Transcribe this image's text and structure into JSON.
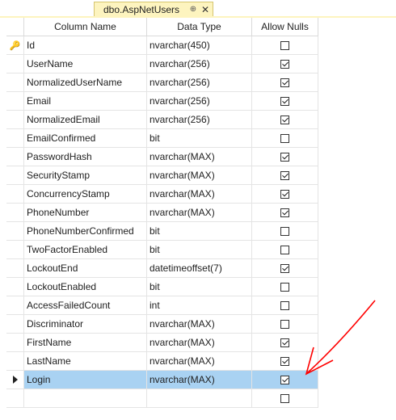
{
  "tab": {
    "title": "dbo.AspNetUsers",
    "pin": "⊕",
    "close": "✕"
  },
  "columns": {
    "name": "Column Name",
    "type": "Data Type",
    "nulls": "Allow Nulls"
  },
  "rows": [
    {
      "name": "Id",
      "type": "nvarchar(450)",
      "nulls": false,
      "key": true
    },
    {
      "name": "UserName",
      "type": "nvarchar(256)",
      "nulls": true
    },
    {
      "name": "NormalizedUserName",
      "type": "nvarchar(256)",
      "nulls": true
    },
    {
      "name": "Email",
      "type": "nvarchar(256)",
      "nulls": true
    },
    {
      "name": "NormalizedEmail",
      "type": "nvarchar(256)",
      "nulls": true
    },
    {
      "name": "EmailConfirmed",
      "type": "bit",
      "nulls": false
    },
    {
      "name": "PasswordHash",
      "type": "nvarchar(MAX)",
      "nulls": true
    },
    {
      "name": "SecurityStamp",
      "type": "nvarchar(MAX)",
      "nulls": true
    },
    {
      "name": "ConcurrencyStamp",
      "type": "nvarchar(MAX)",
      "nulls": true
    },
    {
      "name": "PhoneNumber",
      "type": "nvarchar(MAX)",
      "nulls": true
    },
    {
      "name": "PhoneNumberConfirmed",
      "type": "bit",
      "nulls": false
    },
    {
      "name": "TwoFactorEnabled",
      "type": "bit",
      "nulls": false
    },
    {
      "name": "LockoutEnd",
      "type": "datetimeoffset(7)",
      "nulls": true
    },
    {
      "name": "LockoutEnabled",
      "type": "bit",
      "nulls": false
    },
    {
      "name": "AccessFailedCount",
      "type": "int",
      "nulls": false
    },
    {
      "name": "Discriminator",
      "type": "nvarchar(MAX)",
      "nulls": false
    },
    {
      "name": "FirstName",
      "type": "nvarchar(MAX)",
      "nulls": true
    },
    {
      "name": "LastName",
      "type": "nvarchar(MAX)",
      "nulls": true
    },
    {
      "name": "Login",
      "type": "nvarchar(MAX)",
      "nulls": true,
      "selected": true
    },
    {
      "name": "",
      "type": "",
      "nulls": false,
      "empty": true
    }
  ],
  "annotation": {
    "color": "#ff0000"
  }
}
